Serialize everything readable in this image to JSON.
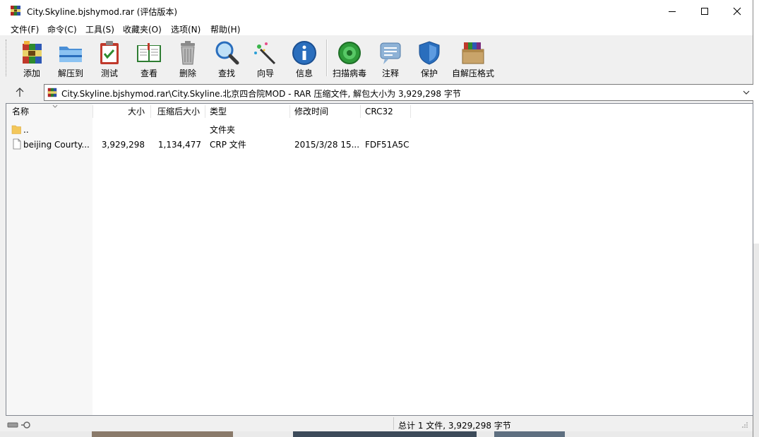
{
  "window": {
    "title": "City.Skyline.bjshymod.rar (评估版本)",
    "controls": {
      "minimize": "minimize-icon",
      "maximize": "maximize-icon",
      "close": "close-icon"
    }
  },
  "menu": [
    "文件(F)",
    "命令(C)",
    "工具(S)",
    "收藏夹(O)",
    "选项(N)",
    "帮助(H)"
  ],
  "toolbar": {
    "buttons": [
      {
        "label": "添加",
        "icon": "add-archive-icon"
      },
      {
        "label": "解压到",
        "icon": "extract-folder-icon"
      },
      {
        "label": "测试",
        "icon": "test-clipboard-icon"
      },
      {
        "label": "查看",
        "icon": "view-book-icon"
      },
      {
        "label": "删除",
        "icon": "trash-icon"
      },
      {
        "label": "查找",
        "icon": "magnifier-icon"
      },
      {
        "label": "向导",
        "icon": "wizard-wand-icon"
      },
      {
        "label": "信息",
        "icon": "info-icon"
      },
      {
        "label": "扫描病毒",
        "icon": "virus-scan-icon"
      },
      {
        "label": "注释",
        "icon": "comment-icon"
      },
      {
        "label": "保护",
        "icon": "shield-icon"
      },
      {
        "label": "自解压格式",
        "icon": "sfx-box-icon"
      }
    ]
  },
  "address": {
    "path": "City.Skyline.bjshymod.rar\\City.Skyline.北京四合院MOD - RAR 压缩文件, 解包大小为 3,929,298 字节"
  },
  "columns": [
    "名称",
    "大小",
    "压缩后大小",
    "类型",
    "修改时间",
    "CRC32"
  ],
  "rows": [
    {
      "name": "..",
      "size": "",
      "packed": "",
      "type": "文件夹",
      "modified": "",
      "crc": "",
      "icon": "folder-icon"
    },
    {
      "name": "beijing Courty...",
      "size": "3,929,298",
      "packed": "1,134,477",
      "type": "CRP 文件",
      "modified": "2015/3/28 15...",
      "crc": "FDF51A5C",
      "icon": "file-icon"
    }
  ],
  "status": {
    "summary": "总计 1 文件, 3,929,298 字节"
  },
  "colors": {
    "accent": "#2a6ebd",
    "window_bg": "#f0f0f0",
    "list_bg": "#ffffff"
  }
}
